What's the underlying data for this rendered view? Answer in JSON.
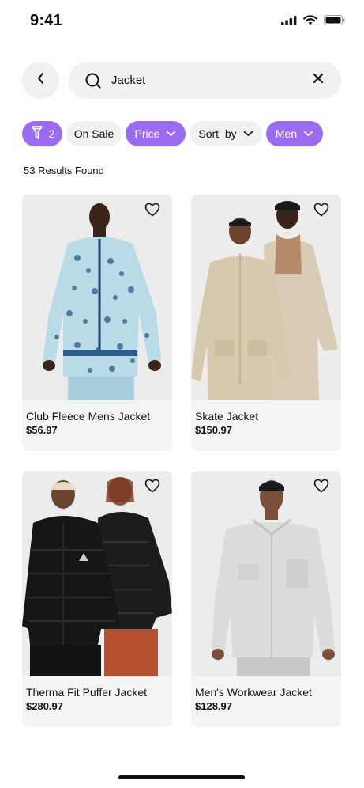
{
  "status_bar": {
    "time": "9:41",
    "icons": [
      "cellular-signal-icon",
      "wifi-icon",
      "battery-icon"
    ]
  },
  "header": {
    "back_icon": "chevron-left-icon",
    "search": {
      "icon": "search-icon",
      "value": "Jacket",
      "clear_icon": "close-icon"
    }
  },
  "filters": {
    "filter_chip": {
      "icon": "filter-icon",
      "count": "2",
      "active": true
    },
    "chips": [
      {
        "label": "On Sale",
        "active": false,
        "has_dropdown": false
      },
      {
        "label": "Price",
        "active": true,
        "has_dropdown": true
      },
      {
        "label": "Sort  by",
        "active": false,
        "has_dropdown": true
      },
      {
        "label": "Men",
        "active": true,
        "has_dropdown": true
      }
    ]
  },
  "results": {
    "text": "53 Results Found"
  },
  "products": [
    {
      "name": "Club Fleece Mens Jacket",
      "price": "$56.97",
      "favorite_icon": "heart-outline-icon"
    },
    {
      "name": "Skate Jacket",
      "price": "$150.97",
      "favorite_icon": "heart-outline-icon"
    },
    {
      "name": "Therma Fit Puffer Jacket",
      "price": "$280.97",
      "favorite_icon": "heart-outline-icon"
    },
    {
      "name": "Men's Workwear Jacket",
      "price": "$128.97",
      "favorite_icon": "heart-outline-icon"
    }
  ],
  "colors": {
    "accent": "#9b6cf0",
    "chip_bg": "#f1f1f1",
    "card_bg": "#f4f4f4",
    "text": "#111111"
  }
}
